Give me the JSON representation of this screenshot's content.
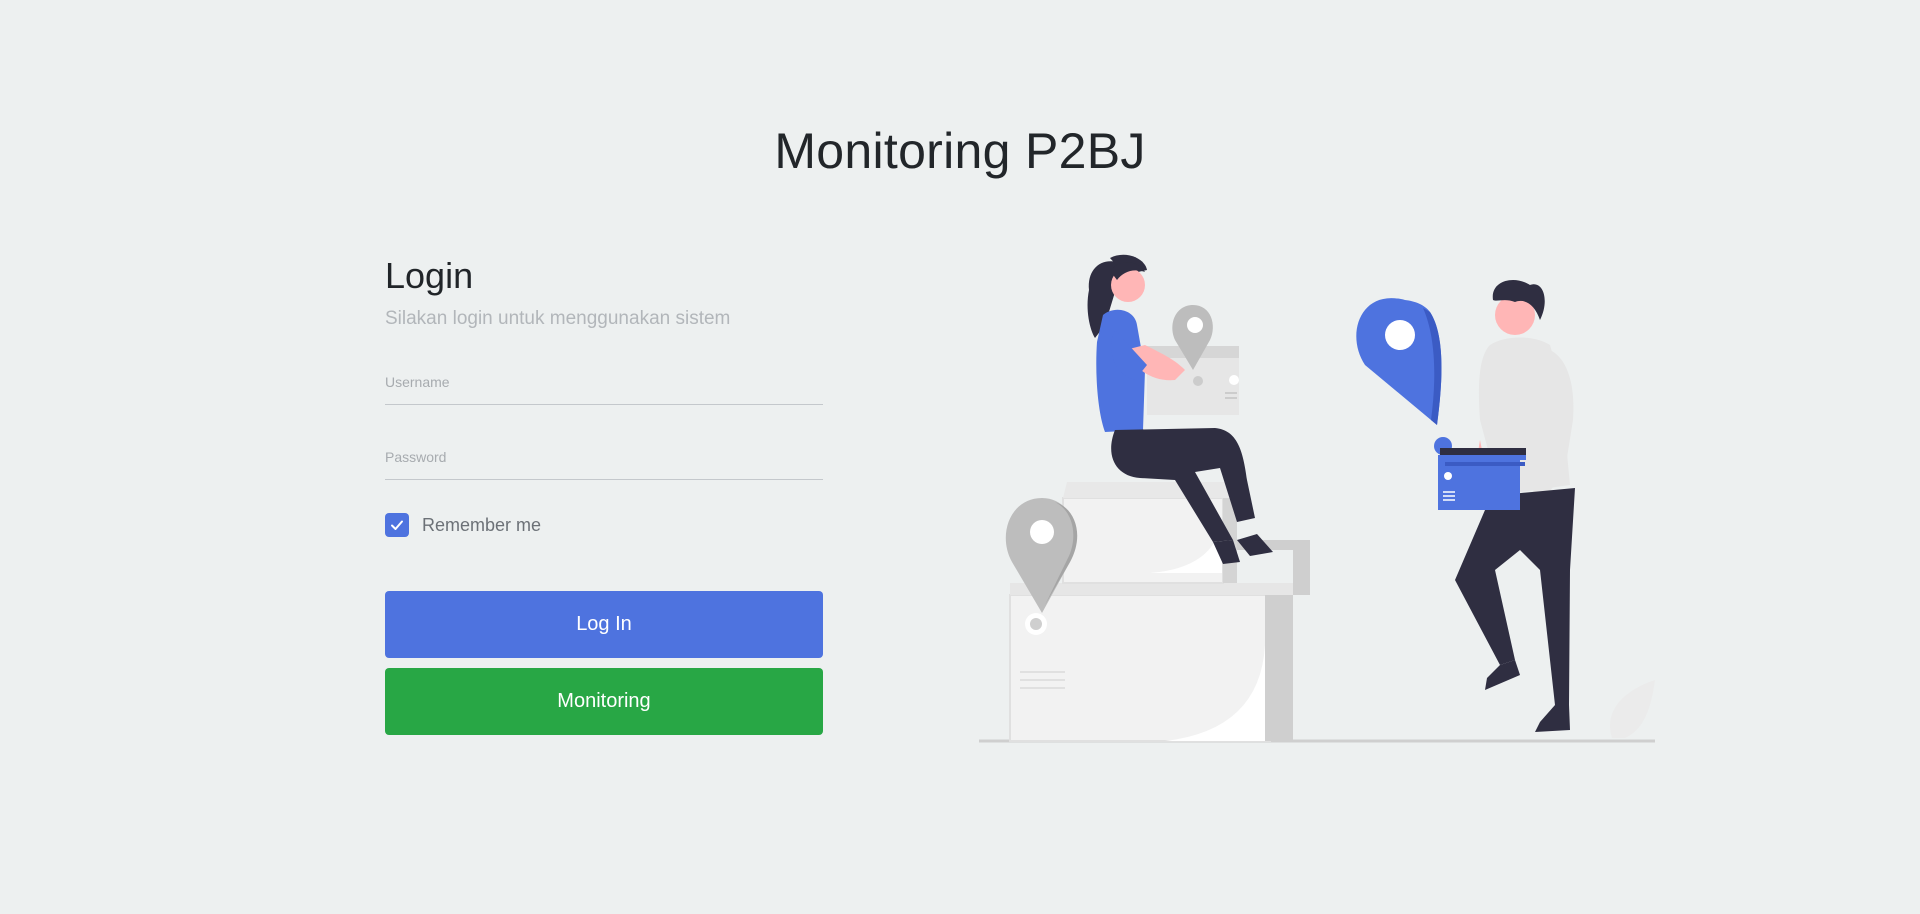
{
  "app": {
    "title": "Monitoring P2BJ"
  },
  "login": {
    "heading": "Login",
    "subtitle": "Silakan login untuk menggunakan sistem",
    "username_label": "Username",
    "password_label": "Password",
    "remember_label": "Remember me",
    "remember_checked": true,
    "login_button": "Log In",
    "monitoring_button": "Monitoring"
  },
  "icons": {
    "checkbox": "check-icon",
    "illustration": "delivery-illustration"
  },
  "colors": {
    "background": "#edf0f0",
    "primary": "#4e73df",
    "success": "#28a745",
    "muted_text": "#b2b6ba",
    "dark_figure": "#2f2e41",
    "skin": "#ffb6b6"
  }
}
